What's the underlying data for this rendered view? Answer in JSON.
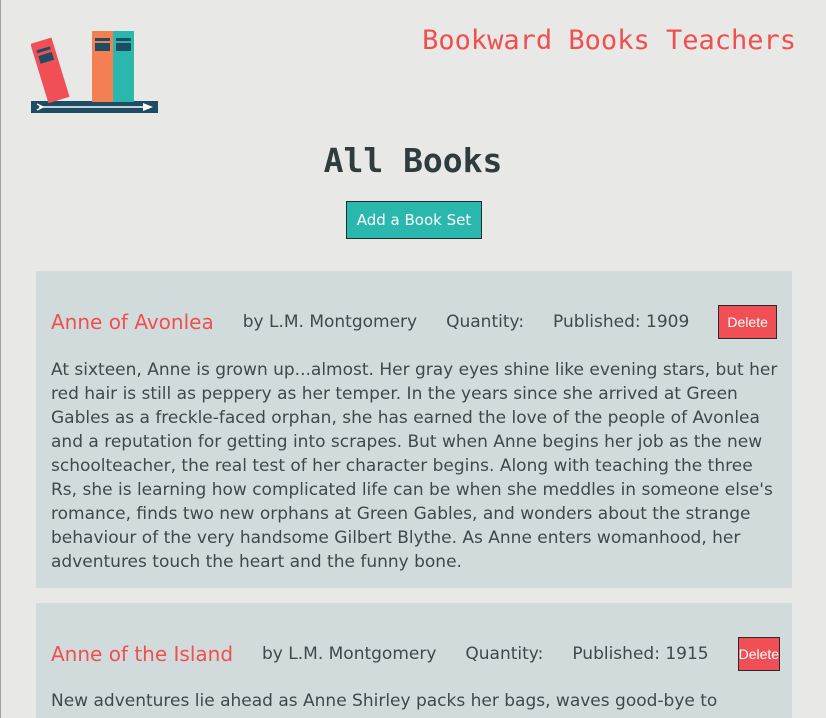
{
  "header": {
    "brand": "Bookward Books Teachers",
    "logo_icon": "books-logo-icon"
  },
  "main": {
    "title": "All Books",
    "add_button_label": "Add a Book Set"
  },
  "books": [
    {
      "title": "Anne of Avonlea",
      "author": "by L.M. Montgomery",
      "quantity": "Quantity:",
      "published": "Published: 1909",
      "delete_label": "Delete",
      "description": "At sixteen, Anne is grown up...almost. Her gray eyes shine like evening stars, but her red hair is still as peppery as her temper. In the years since she arrived at Green Gables as a freckle-faced orphan, she has earned the love of the people of Avonlea and a reputation for getting into scrapes. But when Anne begins her job as the new schoolteacher, the real test of her character begins. Along with teaching the three Rs, she is learning how complicated life can be when she meddles in someone else's romance, finds two new orphans at Green Gables, and wonders about the strange behaviour of the very handsome Gilbert Blythe. As Anne enters womanhood, her adventures touch the heart and the funny bone."
    },
    {
      "title": "Anne of the Island",
      "author": "by L.M. Montgomery",
      "quantity": "Quantity:",
      "published": "Published: 1915",
      "delete_label": "Delete",
      "description": "New adventures lie ahead as Anne Shirley packs her bags, waves good-bye to"
    }
  ],
  "colors": {
    "accent_red": "#ef4f4f",
    "accent_teal": "#2ab7ae",
    "card_bg": "#d2dbdb",
    "page_bg": "#e8e8e6"
  }
}
